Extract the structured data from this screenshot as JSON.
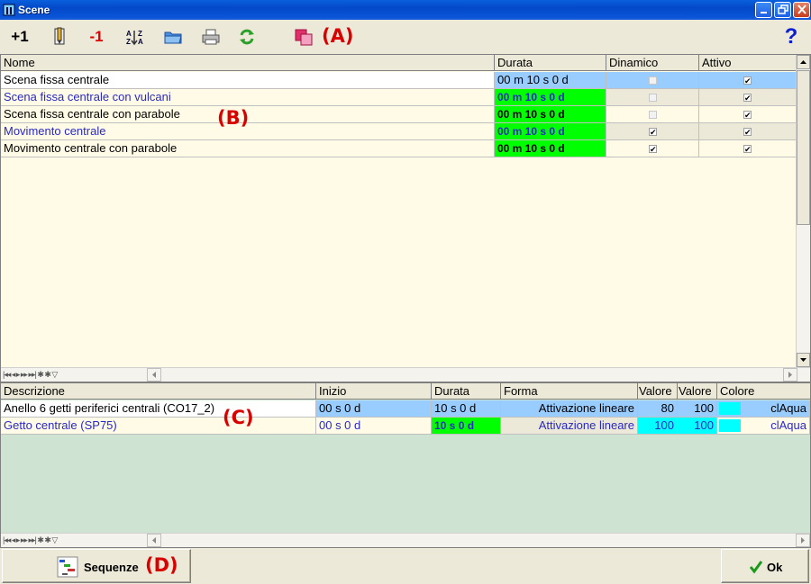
{
  "window": {
    "title": "Scene"
  },
  "toolbar": {
    "add_label": "+1",
    "remove_label": "-1",
    "help_label": "?",
    "annotation_a": "(A)"
  },
  "scenes": {
    "annotation_b": "(B)",
    "columns": [
      "Nome",
      "Durata",
      "Dinamico",
      "Attivo"
    ],
    "rows": [
      {
        "nome": "Scena fissa centrale",
        "durata": "00 m 10 s 0 d",
        "dinamico": false,
        "attivo": true
      },
      {
        "nome": "Scena fissa centrale con vulcani",
        "durata": "00 m 10 s 0 d",
        "dinamico": false,
        "attivo": true
      },
      {
        "nome": "Scena fissa centrale con parabole",
        "durata": "00 m 10 s 0 d",
        "dinamico": false,
        "attivo": true
      },
      {
        "nome": "Movimento centrale",
        "durata": "00 m 10 s 0 d",
        "dinamico": true,
        "attivo": true
      },
      {
        "nome": "Movimento centrale con parabole",
        "durata": "00 m 10 s 0 d",
        "dinamico": true,
        "attivo": true
      }
    ],
    "nav_symbols": "|◂◂ ◂ ▸ ▸▸ ▸▸| ✱ ✱ ▽"
  },
  "effects": {
    "annotation_c": "(C)",
    "columns": [
      "Descrizione",
      "Inizio",
      "Durata",
      "Forma",
      "Valore",
      "Valore",
      "Colore"
    ],
    "rows": [
      {
        "descrizione": "Anello 6 getti periferici centrali (CO17_2)",
        "inizio": "00 s 0 d",
        "durata": "10 s 0 d",
        "forma": "Attivazione lineare",
        "valore1": "80",
        "valore2": "100",
        "colore": "clAqua"
      },
      {
        "descrizione": "Getto centrale (SP75)",
        "inizio": "00 s 0 d",
        "durata": "10 s 0 d",
        "forma": "Attivazione lineare",
        "valore1": "100",
        "valore2": "100",
        "colore": "clAqua"
      }
    ],
    "nav_symbols": "|◂◂ ◂ ▸ ▸▸ ▸▸| ✱ ✱ ▽"
  },
  "bottom": {
    "sequenze_label": "Sequenze",
    "annotation_d": "(D)",
    "ok_label": "Ok"
  },
  "colors": {
    "selected_row": "#99ccff",
    "green_cell": "#00ff00",
    "aqua": "#00ffff",
    "link_blue": "#2929c6",
    "grid_bg": "#fffbe7",
    "effects_bg": "#cfe3d2"
  }
}
